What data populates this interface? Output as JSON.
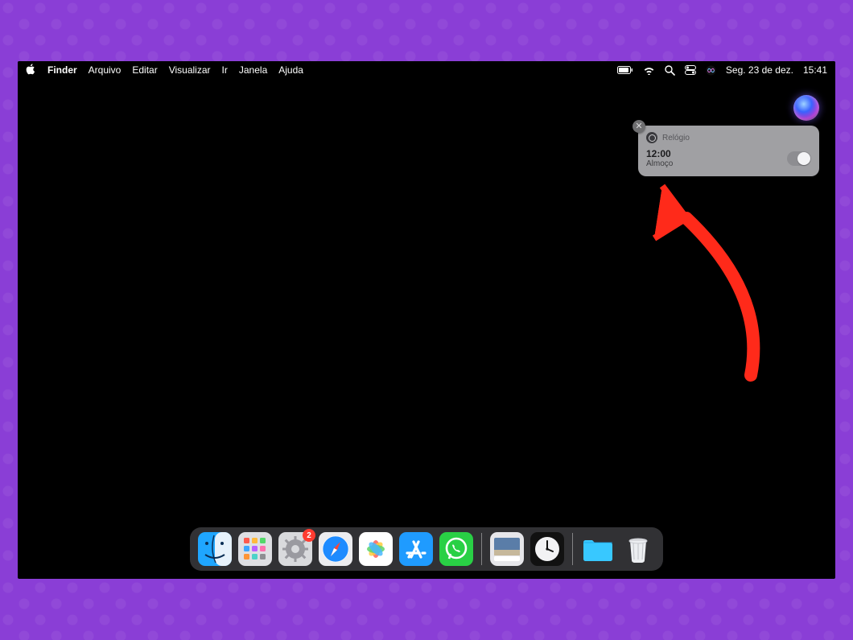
{
  "menubar": {
    "app": "Finder",
    "items": [
      "Arquivo",
      "Editar",
      "Visualizar",
      "Ir",
      "Janela",
      "Ajuda"
    ],
    "date": "Seg. 23 de dez.",
    "time": "15:41"
  },
  "notification": {
    "app": "Relógio",
    "time": "12:00",
    "subtitle": "Almoço",
    "close_glyph": "✕"
  },
  "dock": {
    "settings_badge": "2",
    "items": {
      "finder": "finder",
      "launchpad": "launchpad",
      "settings": "settings",
      "safari": "safari",
      "photos": "photos",
      "appstore": "app-store",
      "whatsapp": "whatsapp",
      "preview": "preview",
      "clock": "clock",
      "folder": "downloads-folder",
      "trash": "trash"
    }
  }
}
